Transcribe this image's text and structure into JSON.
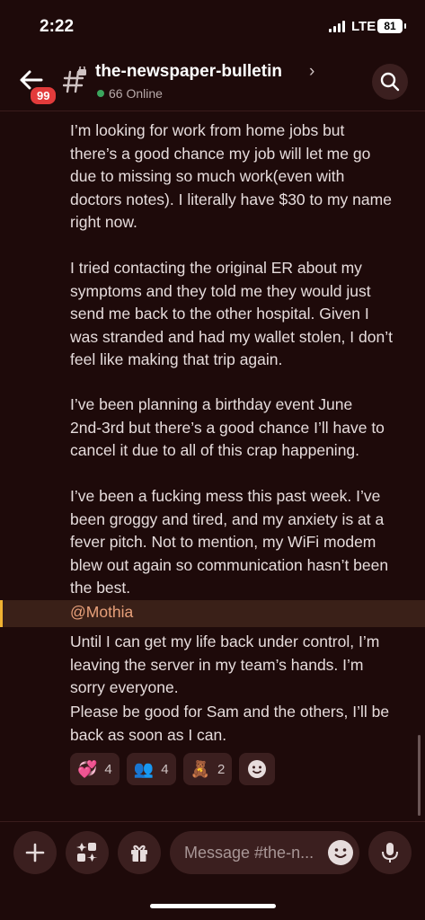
{
  "status_bar": {
    "time": "2:22",
    "network": "LTE",
    "battery": "81"
  },
  "header": {
    "unread_badge": "99",
    "channel_name": "the-newspaper-bulletin",
    "online_count": "66 Online",
    "icons": {
      "back": "back-arrow-icon",
      "channel": "locked-hash-icon",
      "search": "search-icon"
    }
  },
  "messages": {
    "top_partial": "I’m looking for work from home jobs but\nthere’s a good chance my job will let me go\ndue to missing so much work(even with\ndoctors notes). I literally have $30 to my name\nright now.",
    "paragraph_2": "I tried contacting the original ER about my\nsymptoms and they told me they would just\nsend me back to the other hospital. Given I\nwas stranded and had my wallet stolen, I don’t\nfeel like making that trip again.",
    "paragraph_3": "I’ve been planning a birthday event June\n2nd-3rd but there’s a good chance I’ll have to\ncancel it due to all of this crap happening.",
    "paragraph_4": "I’ve been a fucking mess this past week. I’ve\nbeen groggy and tired, and my anxiety is at a\nfever pitch. Not to mention, my WiFi modem\nblew out again so communication hasn’t been\nthe best.",
    "mention": "@Mothia",
    "paragraph_5": "Until I can get my life back under control, I’m\nleaving the server in my team’s hands. I’m\nsorry everyone.",
    "paragraph_6": "Please be good for Sam and the others, I’ll be\nback as soon as I can."
  },
  "reactions": [
    {
      "emoji": "💞",
      "count": "4"
    },
    {
      "emoji": "👥",
      "count": "4"
    },
    {
      "emoji": "🧸",
      "count": "2"
    }
  ],
  "composer": {
    "placeholder": "Message #the-n...",
    "icons": [
      "plus-icon",
      "apps-icon",
      "gift-icon",
      "emoji-icon",
      "microphone-icon"
    ]
  },
  "colors": {
    "background": "#1e0a0a",
    "mention_highlight": "#3a2018",
    "mention_bar": "#f0b232",
    "badge": "#e23b3b"
  }
}
